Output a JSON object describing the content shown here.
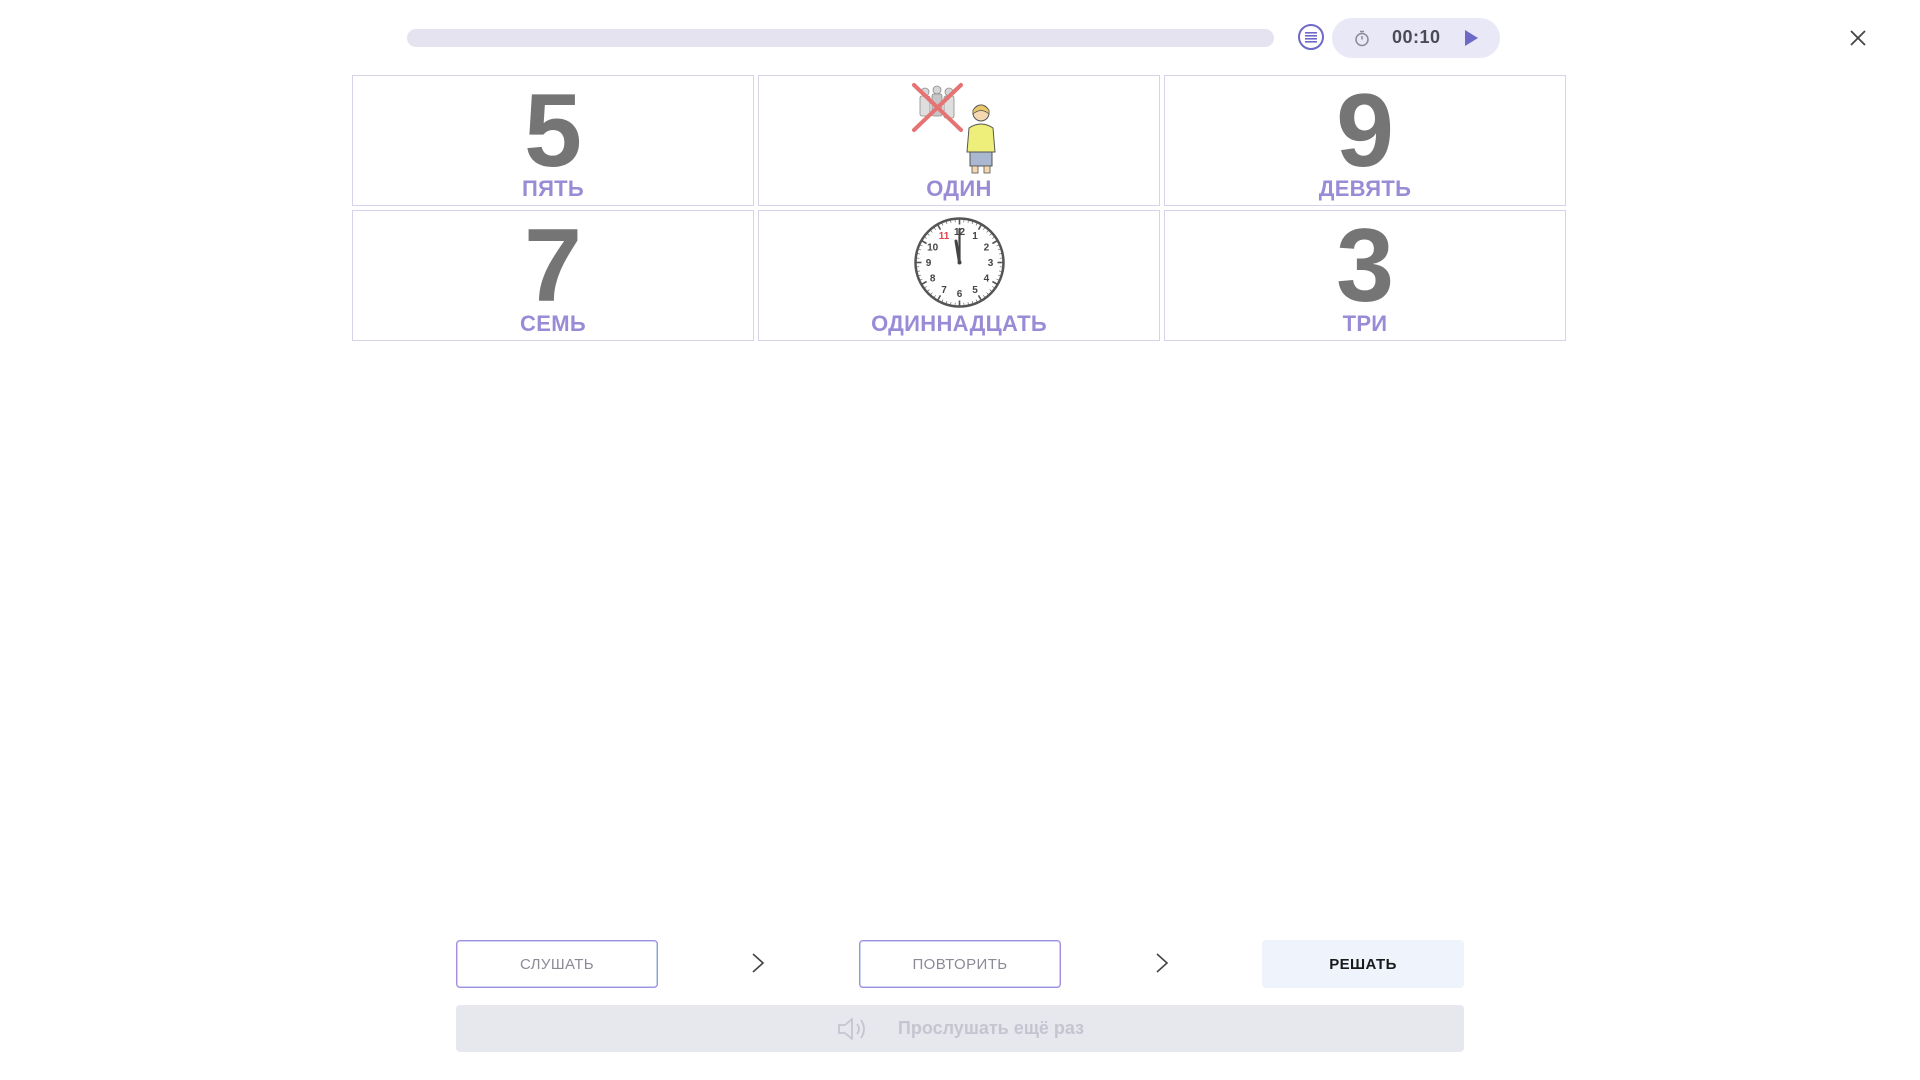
{
  "header": {
    "progress": 0.0,
    "timer": "00:10",
    "icons": {
      "list": "list-icon",
      "stopwatch": "stopwatch-icon",
      "play": "play-icon",
      "close": "close-icon"
    }
  },
  "cards": [
    {
      "digit": "5",
      "label": "ПЯТЬ"
    },
    {
      "digit": "",
      "label": "ОДИН",
      "image": "one-person-icon"
    },
    {
      "digit": "9",
      "label": "ДЕВЯТЬ"
    },
    {
      "digit": "7",
      "label": "СЕМЬ"
    },
    {
      "digit": "",
      "label": "ОДИННАДЦАТЬ",
      "image": "clock-icon"
    },
    {
      "digit": "3",
      "label": "ТРИ"
    }
  ],
  "clock": {
    "numerals": [
      "12",
      "1",
      "2",
      "3",
      "4",
      "5",
      "6",
      "7",
      "8",
      "9",
      "10",
      "11"
    ]
  },
  "controls": {
    "listen_label": "СЛУШАТЬ",
    "repeat_label": "ПОВТОРИТЬ",
    "solve_label": "РЕШАТЬ",
    "replay_label": "Прослушать ещё раз"
  },
  "colors": {
    "accent": "#6d69c7",
    "label": "#9a8bd6",
    "digit": "#757575",
    "clock_highlight": "#e0454a"
  }
}
